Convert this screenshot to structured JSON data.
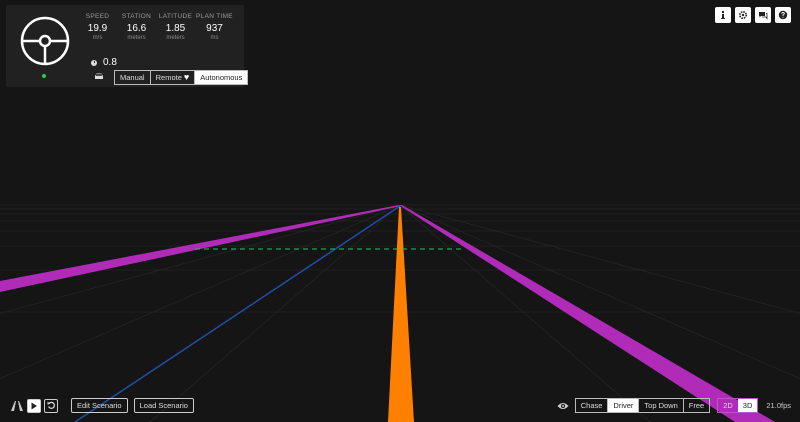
{
  "status_panel": {
    "metrics": [
      {
        "label": "SPEED",
        "value": "19.9",
        "unit": "m/s"
      },
      {
        "label": "STATION",
        "value": "16.6",
        "unit": "meters"
      },
      {
        "label": "LATITUDE",
        "value": "1.85",
        "unit": "meters"
      },
      {
        "label": "PLAN TIME",
        "value": "937",
        "unit": "ms"
      }
    ],
    "steering_value": "0.8",
    "modes": [
      "Manual",
      "Remote",
      "Autonomous"
    ],
    "active_mode": "Autonomous",
    "status_color": "#2ecc40"
  },
  "top_buttons": [
    "info-icon",
    "gear-icon",
    "chat-icon",
    "help-icon"
  ],
  "bottom_left": {
    "icons": [
      "route-icon",
      "play-icon",
      "restart-icon"
    ],
    "edit_label": "Edit Scenario",
    "load_label": "Load Scenario"
  },
  "bottom_right": {
    "camera_modes": [
      "Chase",
      "Driver",
      "Top Down",
      "Free"
    ],
    "active_camera": "Driver",
    "dims": [
      "2D",
      "3D"
    ],
    "active_dim": "3D",
    "fps": "21.0fps"
  },
  "colors": {
    "lane_magenta": "#b02cb8",
    "path_orange": "#ff7f00",
    "path_blue": "#1f4fa8",
    "stopline_green": "#22c55e",
    "background": "#151515"
  }
}
